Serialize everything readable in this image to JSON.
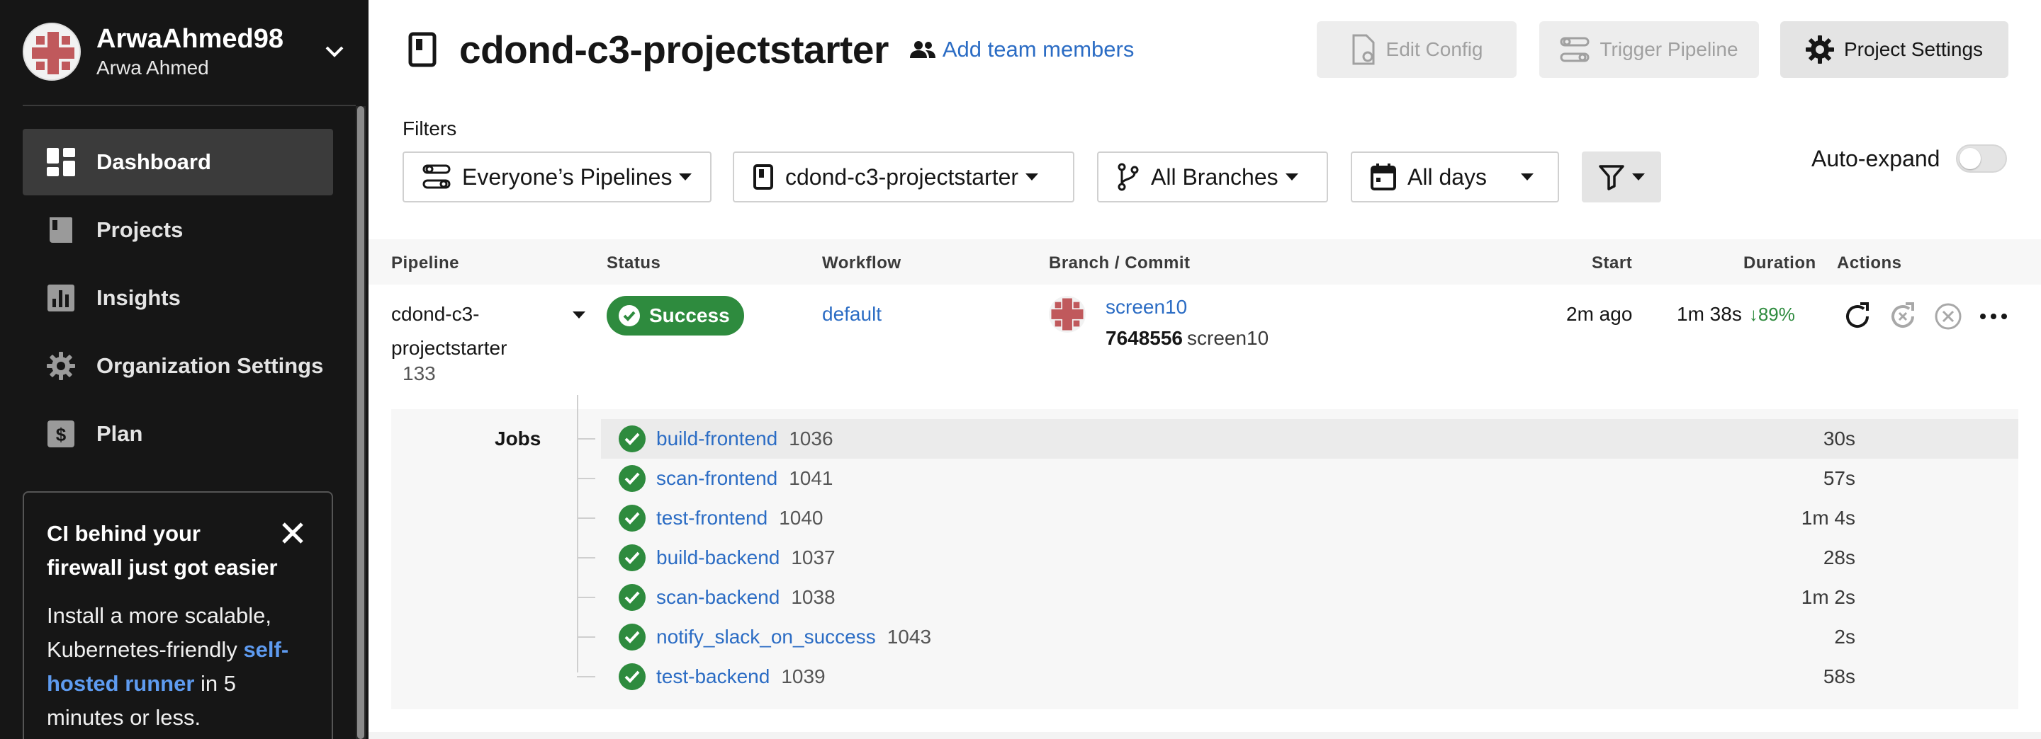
{
  "user": {
    "name": "ArwaAhmed98",
    "org": "Arwa Ahmed"
  },
  "nav": {
    "items": [
      {
        "label": "Dashboard",
        "icon": "dashboard-icon",
        "active": true
      },
      {
        "label": "Projects",
        "icon": "projects-icon"
      },
      {
        "label": "Insights",
        "icon": "insights-icon"
      },
      {
        "label": "Organization Settings",
        "icon": "gear-icon"
      },
      {
        "label": "Plan",
        "icon": "dollar-icon"
      }
    ]
  },
  "promo": {
    "title": "CI behind your firewall just got easier",
    "body_before": "Install a more scalable, Kubernetes-friendly ",
    "link": "self-hosted runner",
    "body_after": " in 5 minutes or less."
  },
  "header": {
    "title": "cdond-c3-projectstarter",
    "add_team": "Add team members",
    "edit_config": "Edit Config",
    "trigger_pipeline": "Trigger Pipeline",
    "project_settings": "Project Settings"
  },
  "filters": {
    "label": "Filters",
    "pipelines": "Everyone’s Pipelines",
    "project": "cdond-c3-projectstarter",
    "branches": "All Branches",
    "days": "All days",
    "auto_expand": "Auto-expand",
    "auto_expand_on": false
  },
  "table": {
    "headers": {
      "pipeline": "Pipeline",
      "status": "Status",
      "workflow": "Workflow",
      "branch_commit": "Branch / Commit",
      "start": "Start",
      "duration": "Duration",
      "actions": "Actions"
    },
    "row": {
      "pipeline": "cdond-c3-projectstarter",
      "number": "133",
      "status": "Success",
      "workflow": "default",
      "branch": "screen10",
      "commit_hash": "7648556",
      "commit_msg": "screen10",
      "start": "2m ago",
      "duration": "1m 38s",
      "duration_change": "89%"
    }
  },
  "jobs": {
    "label": "Jobs",
    "items": [
      {
        "name": "build-frontend",
        "number": "1036",
        "duration": "30s"
      },
      {
        "name": "scan-frontend",
        "number": "1041",
        "duration": "57s"
      },
      {
        "name": "test-frontend",
        "number": "1040",
        "duration": "1m 4s"
      },
      {
        "name": "build-backend",
        "number": "1037",
        "duration": "28s"
      },
      {
        "name": "scan-backend",
        "number": "1038",
        "duration": "1m 2s"
      },
      {
        "name": "notify_slack_on_success",
        "number": "1043",
        "duration": "2s"
      },
      {
        "name": "test-backend",
        "number": "1039",
        "duration": "58s"
      }
    ]
  },
  "colors": {
    "sidebar": "#161616",
    "success": "#2e8b3e",
    "link": "#2b6cc4"
  }
}
